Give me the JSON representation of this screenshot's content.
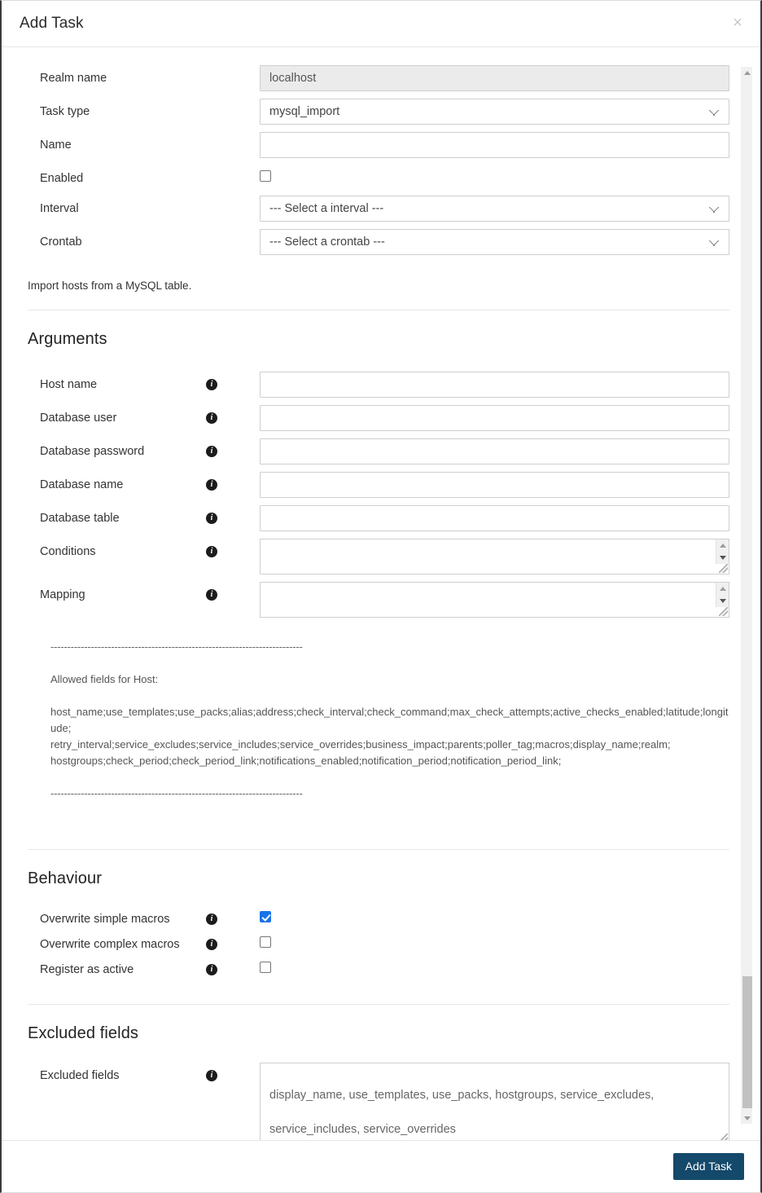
{
  "modal": {
    "title": "Add Task",
    "close_label": "×"
  },
  "form": {
    "realm_name": {
      "label": "Realm name",
      "value": "localhost"
    },
    "task_type": {
      "label": "Task type",
      "value": "mysql_import"
    },
    "name": {
      "label": "Name",
      "value": "",
      "placeholder": ""
    },
    "enabled": {
      "label": "Enabled",
      "checked": false
    },
    "interval": {
      "label": "Interval",
      "value": "--- Select a interval ---"
    },
    "crontab": {
      "label": "Crontab",
      "value": "--- Select a crontab ---"
    }
  },
  "description": "Import hosts from a MySQL table.",
  "arguments": {
    "title": "Arguments",
    "fields": [
      {
        "label": "Host name",
        "value": "",
        "type": "text"
      },
      {
        "label": "Database user",
        "value": "",
        "type": "text"
      },
      {
        "label": "Database password",
        "value": "",
        "type": "text"
      },
      {
        "label": "Database name",
        "value": "",
        "type": "text"
      },
      {
        "label": "Database table",
        "value": "",
        "type": "text"
      },
      {
        "label": "Conditions",
        "value": "",
        "type": "textarea"
      },
      {
        "label": "Mapping",
        "value": "",
        "type": "textarea"
      }
    ]
  },
  "allowed_fields": {
    "divider_top": "---------------------------------------------------------------------------",
    "heading": "Allowed fields for Host:",
    "line1": "host_name;use_templates;use_packs;alias;address;check_interval;check_command;max_check_attempts;active_checks_enabled;latitude;longitude;",
    "line2": "retry_interval;service_excludes;service_includes;service_overrides;business_impact;parents;poller_tag;macros;display_name;realm;",
    "line3": "hostgroups;check_period;check_period_link;notifications_enabled;notification_period;notification_period_link;",
    "divider_bottom": "---------------------------------------------------------------------------"
  },
  "behaviour": {
    "title": "Behaviour",
    "items": [
      {
        "label": "Overwrite simple macros",
        "checked": true
      },
      {
        "label": "Overwrite complex macros",
        "checked": false
      },
      {
        "label": "Register as active",
        "checked": false
      }
    ]
  },
  "excluded_fields": {
    "title": "Excluded fields",
    "label": "Excluded fields",
    "value": "display_name, use_templates, use_packs, hostgroups, service_excludes,\nservice_includes, service_overrides"
  },
  "footer": {
    "submit_label": "Add Task"
  },
  "icons": {
    "info": "i"
  },
  "colors": {
    "primary_button": "#14496b",
    "checkbox_checked": "#1a73e8"
  }
}
